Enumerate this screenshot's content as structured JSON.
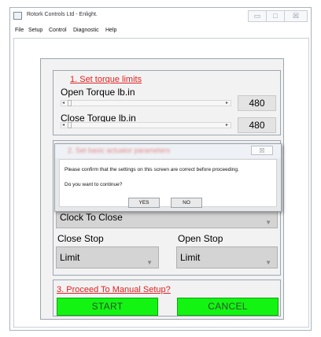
{
  "window": {
    "title": "Rotork Controls Ltd - Enlight.",
    "controls": {
      "minimize": "▭",
      "maximize": "□",
      "close": "☒"
    }
  },
  "menu": [
    "File",
    "Setup",
    "Control",
    "Diagnostic",
    "Help"
  ],
  "step1": {
    "link": "1. Set torque limits",
    "open": {
      "label": "Open  Torque lb.in",
      "value": "480"
    },
    "close": {
      "label": "Close  Torque lb.in",
      "value": "480"
    }
  },
  "step2": {
    "link": "2. Set basic actuator parameters",
    "direction_value": "Clock To Close",
    "close_stop": {
      "label": "Close Stop",
      "value": "Limit"
    },
    "open_stop": {
      "label": "Open Stop",
      "value": "Limit"
    }
  },
  "step3": {
    "link": "3. Proceed To Manual Setup?",
    "start": "START",
    "cancel": "CANCEL"
  },
  "dialog": {
    "close_glyph": "☒",
    "message1": "Please confirm that the settings on this screen are correct before proceeding.",
    "message2": "Do you want to continue?",
    "yes": "YES",
    "no": "NO"
  }
}
